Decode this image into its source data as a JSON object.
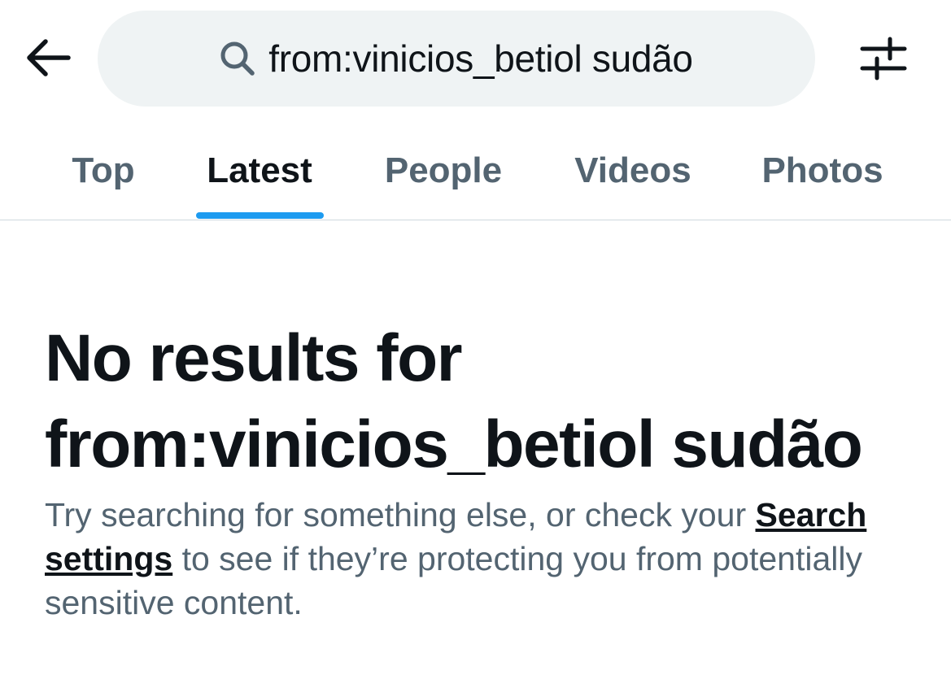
{
  "header": {
    "back_icon": "arrow-left-icon",
    "search_icon": "search-icon",
    "search_query": "from:vinicios_betiol sudão",
    "filter_icon": "sliders-icon"
  },
  "tabs": [
    {
      "label": "Top",
      "active": false
    },
    {
      "label": "Latest",
      "active": true
    },
    {
      "label": "People",
      "active": false
    },
    {
      "label": "Videos",
      "active": false
    },
    {
      "label": "Photos",
      "active": false
    }
  ],
  "empty_state": {
    "title_line1": "No results for",
    "title_line2": "from:vinicios_betiol sudão",
    "body_before": "Try searching for something else, or check your ",
    "link_text": "Search settings",
    "body_after": " to see if they’re protecting you from potentially sensitive content."
  },
  "colors": {
    "accent": "#1d9bf0",
    "text_primary": "#0f1419",
    "text_secondary": "#536471",
    "search_bg": "#eff3f4",
    "divider": "#cfd9de"
  }
}
